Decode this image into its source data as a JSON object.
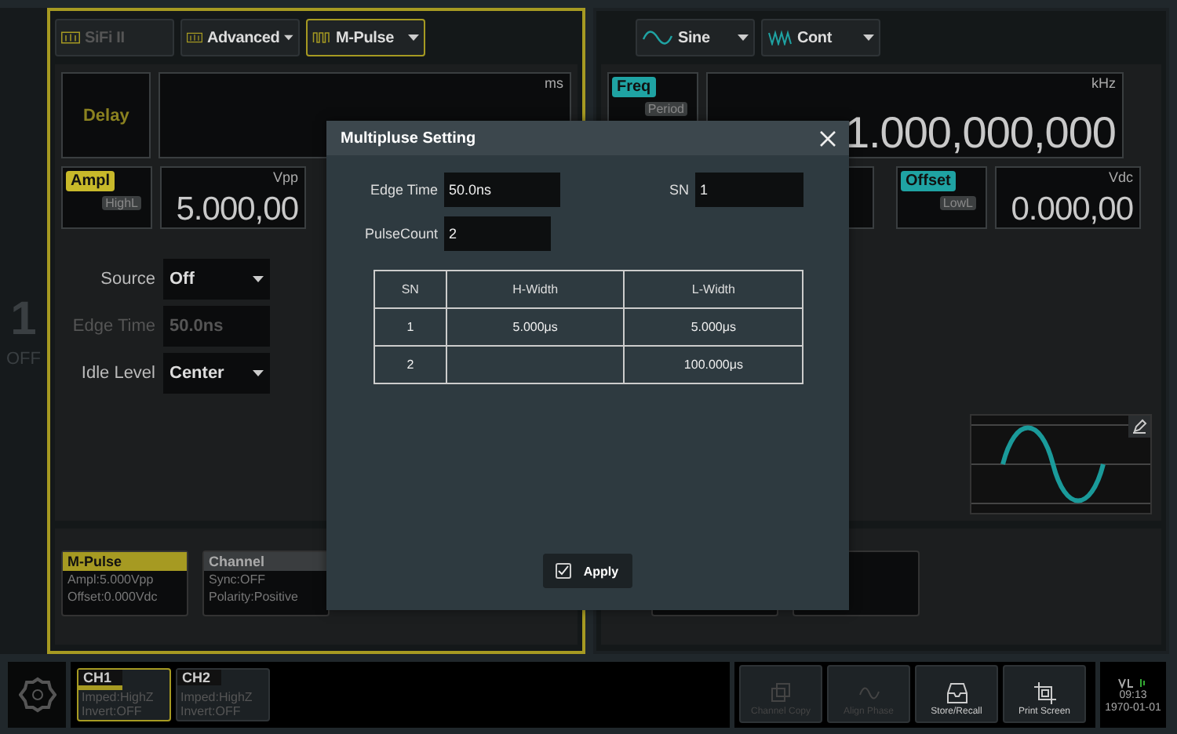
{
  "channel_strip": {
    "number": "1",
    "state": "OFF"
  },
  "ch1_panel": {
    "tabs": [
      {
        "label": "SiFi II",
        "selected": false,
        "disabled": true,
        "dropdown": false
      },
      {
        "label": "Advanced",
        "selected": false,
        "disabled": false,
        "dropdown": true
      },
      {
        "label": "M-Pulse",
        "selected": true,
        "disabled": false,
        "dropdown": true
      }
    ],
    "param_box": {
      "label": "Delay"
    },
    "main_display": {
      "unit": "ms"
    },
    "ampl": {
      "label": "Ampl",
      "alt": "HighL",
      "unit": "Vpp",
      "value": "5.000,00"
    },
    "settings": [
      {
        "label": "Source",
        "value": "Off",
        "kind": "dropdown",
        "disabled": false
      },
      {
        "label": "Edge Time",
        "value": "50.0ns",
        "kind": "field",
        "disabled": true
      },
      {
        "label": "Idle Level",
        "value": "Center",
        "kind": "dropdown",
        "disabled": false
      }
    ],
    "summary_cards": [
      {
        "title": "M-Pulse",
        "lines": [
          "Ampl:5.000Vpp",
          "Offset:0.000Vdc"
        ],
        "selected": true
      },
      {
        "title": "Channel",
        "lines": [
          "Sync:OFF",
          "Polarity:Positive"
        ],
        "selected": false
      }
    ]
  },
  "ch2_panel": {
    "tabs": [
      {
        "label": "Sine",
        "kind": "sine"
      },
      {
        "label": "Cont",
        "kind": "burst"
      }
    ],
    "freq": {
      "label": "Freq",
      "alt": "Period"
    },
    "main_display": {
      "unit": "kHz",
      "value": "1.000,000,000"
    },
    "offset": {
      "label": "Offset",
      "alt": "LowL",
      "unit": "Vdc",
      "value": "0.000,00"
    }
  },
  "dialog": {
    "title": "Multipluse Setting",
    "fields": [
      {
        "label": "Edge Time",
        "value": "50.0ns"
      },
      {
        "label": "SN",
        "value": "1"
      },
      {
        "label": "PulseCount",
        "value": "2"
      }
    ],
    "table": {
      "columns": [
        "SN",
        "H-Width",
        "L-Width"
      ],
      "rows": [
        [
          "1",
          "5.000μs",
          "5.000μs"
        ],
        [
          "2",
          null,
          "100.000μs"
        ]
      ]
    },
    "apply": {
      "label": "Apply",
      "checked": true
    }
  },
  "bottom_bar": {
    "channels": [
      {
        "name": "CH1",
        "lines": [
          "Imped:HighZ",
          "Invert:OFF"
        ],
        "selected": true
      },
      {
        "name": "CH2",
        "lines": [
          "Imped:HighZ",
          "Invert:OFF"
        ],
        "selected": false
      }
    ],
    "actions": [
      {
        "label": "Channel Copy",
        "disabled": true,
        "kind": "copy"
      },
      {
        "label": "Align Phase",
        "disabled": true,
        "kind": "wave"
      },
      {
        "label": "Store/Recall",
        "disabled": false,
        "kind": "tray"
      },
      {
        "label": "Print Screen",
        "disabled": false,
        "kind": "crop"
      }
    ],
    "status": {
      "time": "09:13",
      "date": "1970-01-01"
    }
  }
}
